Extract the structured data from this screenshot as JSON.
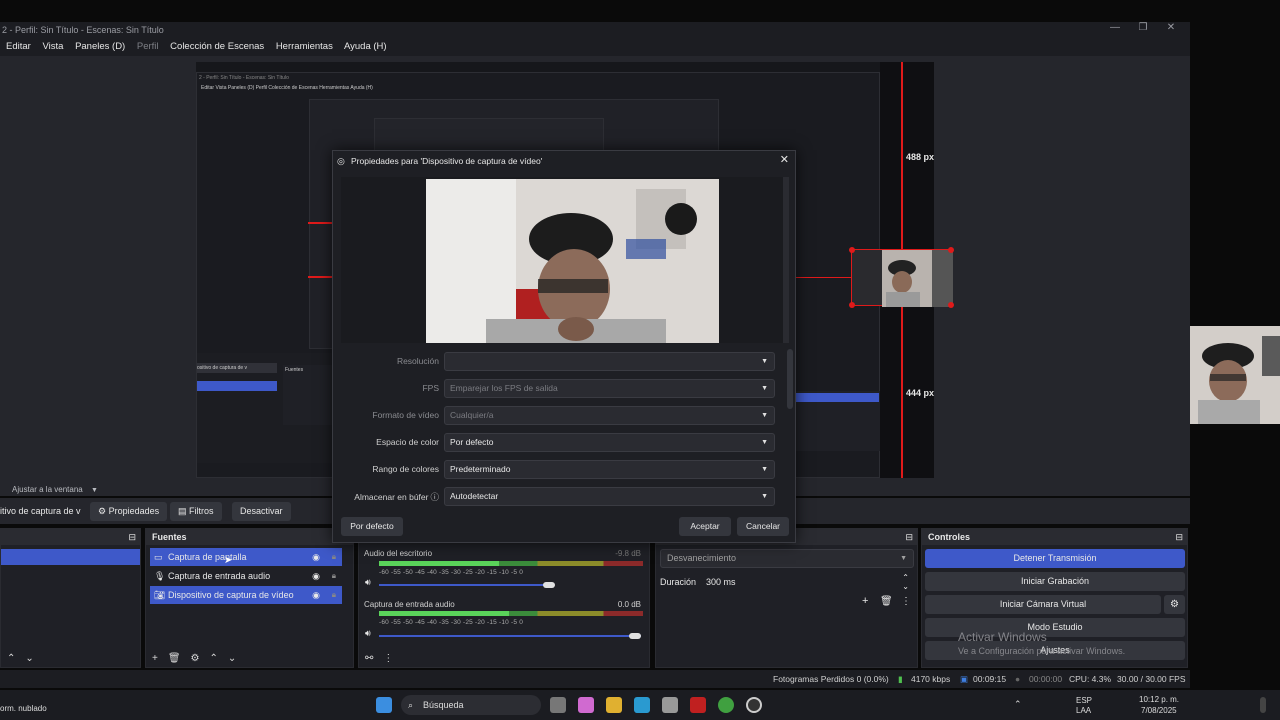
{
  "window": {
    "title": "2 - Perfil: Sin Título - Escenas: Sin Título",
    "controls": [
      "—",
      "❐",
      "✕"
    ]
  },
  "menu": {
    "items": [
      "Editar",
      "Vista",
      "Paneles (D)",
      "Perfil",
      "Colección de Escenas",
      "Herramientas",
      "Ayuda (H)"
    ]
  },
  "preview": {
    "height_label": "488 px",
    "bottom_label": "444 px",
    "nested_menu": "Editar   Vista   Paneles (D)   Perfil   Colección de Escenas   Herramientas   Ayuda (H)",
    "nested_title": "2 - Perfil: Sin Título - Escenas: Sin Título"
  },
  "fit_label": "Ajustar a la ventana",
  "toolbar": {
    "source_name": "itivo de captura de v",
    "properties": "Propiedades",
    "filters": "Filtros",
    "deactivate": "Desactivar"
  },
  "sources": {
    "title": "Fuentes",
    "items": [
      {
        "label": "Captura de pantalla",
        "icon": "monitor-icon"
      },
      {
        "label": "Captura de entrada audio",
        "icon": "mic-icon"
      },
      {
        "label": "Dispositivo de captura de vídeo",
        "icon": "camera-icon"
      }
    ]
  },
  "mixer": {
    "ch1_name": "Audio del escritorio",
    "ch1_db": "-9.8 dB",
    "ch2_name": "Captura de entrada audio",
    "ch2_db": "0.0 dB",
    "scale": "-60  -55  -50  -45  -40  -35  -30  -25  -20  -15  -10  -5  0"
  },
  "transitions": {
    "type": "Desvanecimiento",
    "duration_label": "Duración",
    "duration_value": "300 ms"
  },
  "controls": {
    "title": "Controles",
    "stop_stream": "Detener Transmisión",
    "start_recording": "Iniciar Grabación",
    "start_virtual_cam": "Iniciar Cámara Virtual",
    "studio_mode": "Modo Estudio",
    "settings": "Ajustes"
  },
  "watermark": {
    "line1": "Activar Windows",
    "line2": "Ve a Configuración para activar Windows."
  },
  "status": {
    "dropped": "Fotogramas Perdidos 0 (0.0%)",
    "bitrate": "4170 kbps",
    "stream_time": "00:09:15",
    "rec_time": "00:00:00",
    "cpu": "CPU: 4.3%",
    "fps": "30.00 / 30.00 FPS"
  },
  "taskbar": {
    "weather": "orm. nublado",
    "search": "Búsqueda",
    "lang1": "ESP",
    "lang2": "LAA",
    "time": "10:12 p. m.",
    "date": "7/08/2025"
  },
  "dialog": {
    "title": "Propiedades para 'Dispositivo de captura de vídeo'",
    "properties": [
      {
        "label": "Resolución",
        "value": "",
        "dim": true
      },
      {
        "label": "FPS",
        "value": "Emparejar los FPS de salida",
        "dim": true
      },
      {
        "label": "Formato de vídeo",
        "value": "Cualquier/a",
        "dim": true
      },
      {
        "label": "Espacio de color",
        "value": "Por defecto",
        "dim": false
      },
      {
        "label": "Rango de colores",
        "value": "Predeterminado",
        "dim": false
      },
      {
        "label": "Almacenar en búfer",
        "value": "Autodetectar",
        "dim": false
      }
    ],
    "defaults_button": "Por defecto",
    "accept_button": "Aceptar",
    "cancel_button": "Cancelar"
  }
}
